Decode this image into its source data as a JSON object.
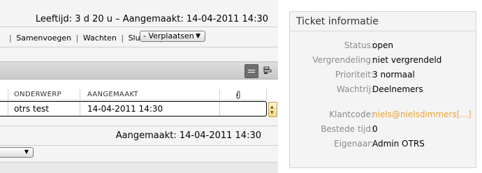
{
  "header": {
    "age_text": "Leeftijd: 3 d 20 u – Aangemaakt: 14-04-2011 14:30"
  },
  "toolbar": {
    "links": [
      "Samenvoegen",
      "Wachten",
      "Sluiten"
    ],
    "move_select": "- Verplaatsen -"
  },
  "table": {
    "columns": [
      "ONDERWERP",
      "AANGEMAAKT"
    ],
    "attachment_icon": "paperclip-icon",
    "rows": [
      {
        "subject": "otrs test",
        "created": "14-04-2011 14:30"
      }
    ]
  },
  "article": {
    "created_text": "Aangemaakt: 14-04-2011 14:30"
  },
  "ticket_info": {
    "title": "Ticket informatie",
    "fields": [
      {
        "label": "Status:",
        "value": "open"
      },
      {
        "label": "Vergrendeling:",
        "value": "niet vergrendeld"
      },
      {
        "label": "Prioriteit:",
        "value": "3 normaal"
      },
      {
        "label": "Wachtrij:",
        "value": "Deelnemers"
      },
      {
        "label": "Klantcode:",
        "value": "niels@nielsdimmers[...]"
      },
      {
        "label": "Bestede tijd:",
        "value": "0"
      },
      {
        "label": "Eigenaar:",
        "value": "Admin OTRS"
      }
    ]
  },
  "colors": {
    "link": "#f0a030",
    "label": "#8a8a8a",
    "panel": "#f4f4f4"
  }
}
